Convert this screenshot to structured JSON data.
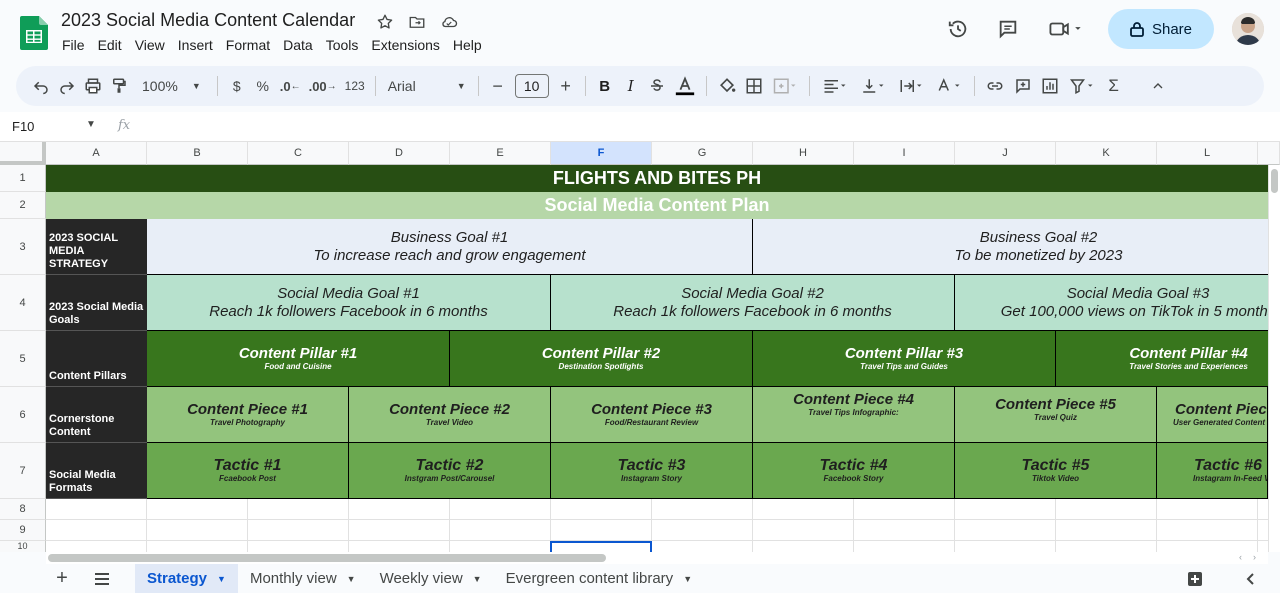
{
  "doc": {
    "title": "2023 Social Media Content Calendar",
    "menu": [
      "File",
      "Edit",
      "View",
      "Insert",
      "Format",
      "Data",
      "Tools",
      "Extensions",
      "Help"
    ],
    "share_label": "Share"
  },
  "toolbar": {
    "zoom": "100%",
    "currency": "$",
    "percent": "%",
    "dec_decrease": ".0",
    "dec_increase": ".00",
    "number_format": "123",
    "font": "Arial",
    "font_size": "10",
    "bold": "B",
    "italic": "I"
  },
  "formula": {
    "name_box": "F10",
    "fx": "fx"
  },
  "columns": [
    "A",
    "B",
    "C",
    "D",
    "E",
    "F",
    "G",
    "H",
    "I",
    "J",
    "K",
    "L"
  ],
  "rows": [
    "1",
    "2",
    "3",
    "4",
    "5",
    "6",
    "7",
    "8",
    "9",
    "10"
  ],
  "sheet": {
    "banner_title": "FLIGHTS AND BITES PH",
    "banner_subtitle": "Social Media Content Plan",
    "row_labels": {
      "strategy": "2023 SOCIAL MEDIA STRATEGY",
      "goals": "2023 Social Media Goals",
      "pillars": "Content Pillars",
      "cornerstone": "Cornerstone Content",
      "formats": "Social Media Formats"
    },
    "business_goals": [
      {
        "title": "Business Goal #1",
        "desc": "To increase reach and grow engagement"
      },
      {
        "title": "Business Goal #2",
        "desc": "To be monetized by 2023"
      }
    ],
    "sm_goals": [
      {
        "title": "Social Media Goal #1",
        "desc": "Reach 1k followers Facebook in 6 months"
      },
      {
        "title": "Social Media Goal #2",
        "desc": "Reach 1k followers Facebook in 6 months"
      },
      {
        "title": "Social Media Goal #3",
        "desc": "Get 100,000 views on TikTok in 5 months"
      }
    ],
    "pillars": [
      {
        "title": "Content Pillar #1",
        "sub": "Food and Cuisine"
      },
      {
        "title": "Content Pillar #2",
        "sub": "Destination Spotlights"
      },
      {
        "title": "Content Pillar #3",
        "sub": "Travel Tips and Guides"
      },
      {
        "title": "Content Pillar #4",
        "sub": "Travel Stories and Experiences"
      }
    ],
    "pieces": [
      {
        "title": "Content Piece #1",
        "sub": "Travel Photography"
      },
      {
        "title": "Content Piece #2",
        "sub": "Travel Video"
      },
      {
        "title": "Content Piece #3",
        "sub": "Food/Restaurant Review"
      },
      {
        "title": "Content Piece #4",
        "sub": "Travel Tips Infographic:"
      },
      {
        "title": "Content Piece #5",
        "sub": "Travel Quiz"
      },
      {
        "title": "Content Piec",
        "sub": "User Generated Content"
      }
    ],
    "tactics": [
      {
        "title": "Tactic #1",
        "sub": "Fcaebook Post"
      },
      {
        "title": "Tactic #2",
        "sub": "Instgram Post/Carousel"
      },
      {
        "title": "Tactic #3",
        "sub": "Instagram Story"
      },
      {
        "title": "Tactic #4",
        "sub": "Facebook Story"
      },
      {
        "title": "Tactic  #5",
        "sub": "Tiktok Video"
      },
      {
        "title": "Tactic #6",
        "sub": "Instagram In-Feed V"
      }
    ]
  },
  "sheet_tabs": [
    {
      "label": "Strategy",
      "active": true
    },
    {
      "label": "Monthly view",
      "active": false
    },
    {
      "label": "Weekly view",
      "active": false
    },
    {
      "label": "Evergreen content library",
      "active": false
    }
  ],
  "colors": {
    "banner_dark": "#274e13",
    "banner_light": "#b6d7a8",
    "pillar": "#38761d",
    "piece": "#93c47d",
    "tactic": "#6aa84f",
    "goal": "#e8eef7",
    "sm_goal": "#b7e1cd",
    "label": "#262626",
    "share": "#c2e7ff"
  }
}
